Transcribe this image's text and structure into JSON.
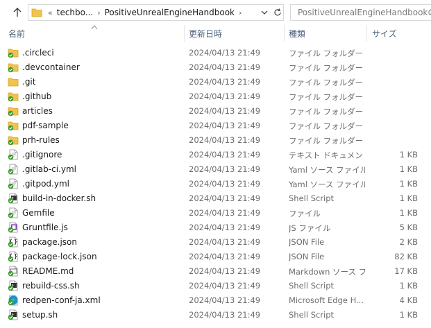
{
  "address_bar": {
    "overflow": "«",
    "crumbs": [
      "techbo...",
      "PositiveUnrealEngineHandbook"
    ]
  },
  "search": {
    "placeholder": "PositiveUnrealEngineHandbookの検索"
  },
  "columns": {
    "name": "名前",
    "date": "更新日時",
    "type": "種類",
    "size": "サイズ"
  },
  "colors": {
    "folder": "#f2c24f",
    "folder_dark": "#d9a426",
    "sync_green": "#3a9c2c",
    "header_text": "#4c607a"
  },
  "files": [
    {
      "name": ".circleci",
      "date": "2024/04/13 21:49",
      "type": "ファイル フォルダー",
      "size": "",
      "icon": "folder-synced-icon"
    },
    {
      "name": ".devcontainer",
      "date": "2024/04/13 21:49",
      "type": "ファイル フォルダー",
      "size": "",
      "icon": "folder-synced-icon"
    },
    {
      "name": ".git",
      "date": "2024/04/13 21:49",
      "type": "ファイル フォルダー",
      "size": "",
      "icon": "folder-icon"
    },
    {
      "name": ".github",
      "date": "2024/04/13 21:49",
      "type": "ファイル フォルダー",
      "size": "",
      "icon": "folder-synced-icon"
    },
    {
      "name": "articles",
      "date": "2024/04/13 21:49",
      "type": "ファイル フォルダー",
      "size": "",
      "icon": "folder-synced-icon"
    },
    {
      "name": "pdf-sample",
      "date": "2024/04/13 21:49",
      "type": "ファイル フォルダー",
      "size": "",
      "icon": "folder-synced-icon"
    },
    {
      "name": "prh-rules",
      "date": "2024/04/13 21:49",
      "type": "ファイル フォルダー",
      "size": "",
      "icon": "folder-synced-icon"
    },
    {
      "name": ".gitignore",
      "date": "2024/04/13 21:49",
      "type": "テキスト ドキュメント",
      "size": "1 KB",
      "icon": "text-file-synced-icon"
    },
    {
      "name": ".gitlab-ci.yml",
      "date": "2024/04/13 21:49",
      "type": "Yaml ソース ファイル",
      "size": "1 KB",
      "icon": "yaml-file-synced-icon"
    },
    {
      "name": ".gitpod.yml",
      "date": "2024/04/13 21:49",
      "type": "Yaml ソース ファイル",
      "size": "1 KB",
      "icon": "yaml-file-synced-icon"
    },
    {
      "name": "build-in-docker.sh",
      "date": "2024/04/13 21:49",
      "type": "Shell Script",
      "size": "1 KB",
      "icon": "shell-file-synced-icon"
    },
    {
      "name": "Gemfile",
      "date": "2024/04/13 21:49",
      "type": "ファイル",
      "size": "1 KB",
      "icon": "file-synced-icon"
    },
    {
      "name": "Gruntfile.js",
      "date": "2024/04/13 21:49",
      "type": "JS ファイル",
      "size": "5 KB",
      "icon": "js-file-synced-icon"
    },
    {
      "name": "package.json",
      "date": "2024/04/13 21:49",
      "type": "JSON File",
      "size": "2 KB",
      "icon": "json-file-synced-icon"
    },
    {
      "name": "package-lock.json",
      "date": "2024/04/13 21:49",
      "type": "JSON File",
      "size": "82 KB",
      "icon": "json-file-synced-icon"
    },
    {
      "name": "README.md",
      "date": "2024/04/13 21:49",
      "type": "Markdown ソース フ...",
      "size": "17 KB",
      "icon": "markdown-file-synced-icon"
    },
    {
      "name": "rebuild-css.sh",
      "date": "2024/04/13 21:49",
      "type": "Shell Script",
      "size": "1 KB",
      "icon": "shell-file-synced-icon"
    },
    {
      "name": "redpen-conf-ja.xml",
      "date": "2024/04/13 21:49",
      "type": "Microsoft Edge H...",
      "size": "4 KB",
      "icon": "edge-file-synced-icon"
    },
    {
      "name": "setup.sh",
      "date": "2024/04/13 21:49",
      "type": "Shell Script",
      "size": "1 KB",
      "icon": "shell-file-synced-icon"
    }
  ]
}
